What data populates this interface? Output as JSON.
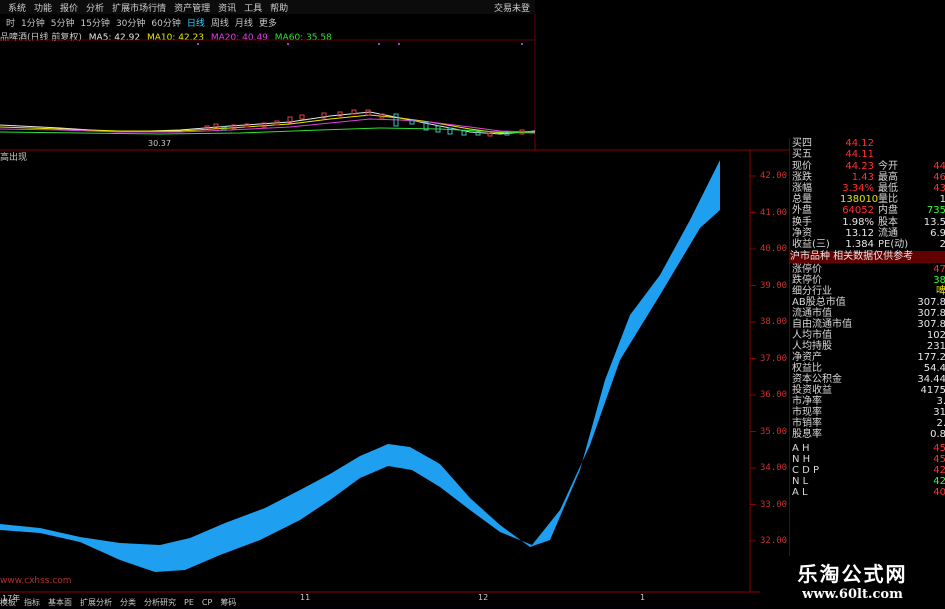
{
  "menu": {
    "items": [
      "系统",
      "功能",
      "报价",
      "分析",
      "扩展市场行情",
      "资产管理",
      "资讯",
      "工具",
      "帮助"
    ],
    "right": "交易未登"
  },
  "periods": {
    "items": [
      "时",
      "1分钟",
      "5分钟",
      "15分钟",
      "30分钟",
      "60分钟",
      "日线",
      "周线",
      "月线",
      "更多"
    ],
    "active": "日线"
  },
  "ma_info": {
    "title": "品啤酒(日线 前复权)",
    "ma5": "MA5: 42.92",
    "ma10": "MA10: 42.23",
    "ma20": "MA20: 40.49",
    "ma60": "MA60: 35.58"
  },
  "top_chart": {
    "low_label": "30.37"
  },
  "sub_chart": {
    "label": "高出现",
    "watermark": "www.cxhss.com"
  },
  "price_scale": [
    "42.00",
    "41.00",
    "40.00",
    "39.00",
    "38.00",
    "37.00",
    "36.00",
    "35.00",
    "34.00",
    "33.00",
    "32.00"
  ],
  "quote": {
    "asks": [
      {
        "label": "买四",
        "value": "44.12"
      },
      {
        "label": "买五",
        "value": "44.11"
      }
    ],
    "rows": [
      {
        "l": "现价",
        "v": "44.23",
        "vc": "red",
        "l2": "今开",
        "v2": "44",
        "v2c": "red"
      },
      {
        "l": "涨跌",
        "v": "1.43",
        "vc": "red",
        "l2": "最高",
        "v2": "46",
        "v2c": "red"
      },
      {
        "l": "涨幅",
        "v": "3.34%",
        "vc": "red",
        "l2": "最低",
        "v2": "43",
        "v2c": "red"
      },
      {
        "l": "总量",
        "v": "138010",
        "vc": "yellow",
        "l2": "量比",
        "v2": "1",
        "v2c": "white"
      },
      {
        "l": "外盘",
        "v": "64052",
        "vc": "red",
        "l2": "内盘",
        "v2": "735",
        "v2c": "green"
      },
      {
        "l": "换手",
        "v": "1.98%",
        "vc": "white",
        "l2": "股本",
        "v2": "13.5",
        "v2c": "white"
      },
      {
        "l": "净资",
        "v": "13.12",
        "vc": "white",
        "l2": "流通",
        "v2": "6.9",
        "v2c": "white"
      },
      {
        "l": "收益(三)",
        "v": "1.384",
        "vc": "white",
        "l2": "PE(动)",
        "v2": "2",
        "v2c": "white"
      }
    ],
    "section_header": "沪市品种  相关数据仅供参考",
    "fund_rows": [
      {
        "l": "涨停价",
        "v": "47",
        "vc": "red"
      },
      {
        "l": "跌停价",
        "v": "38",
        "vc": "green"
      },
      {
        "l": "细分行业",
        "v": "啤",
        "vc": "yellow"
      },
      {
        "l": "AB股总市值",
        "v": "307.8",
        "vc": "white"
      },
      {
        "l": "流通市值",
        "v": "307.8",
        "vc": "white"
      },
      {
        "l": "自由流通市值",
        "v": "307.8",
        "vc": "white"
      },
      {
        "l": "人均市值",
        "v": "102",
        "vc": "white"
      },
      {
        "l": "人均持股",
        "v": "231",
        "vc": "white"
      },
      {
        "l": "净资产",
        "v": "177.2",
        "vc": "white"
      },
      {
        "l": "权益比",
        "v": "54.4",
        "vc": "white"
      },
      {
        "l": "资本公积金",
        "v": "34.44",
        "vc": "white"
      },
      {
        "l": "投资收益",
        "v": "4175",
        "vc": "white"
      },
      {
        "l": "市净率",
        "v": "3.",
        "vc": "white"
      },
      {
        "l": "市现率",
        "v": "31",
        "vc": "white"
      },
      {
        "l": "市销率",
        "v": "2.",
        "vc": "white"
      },
      {
        "l": "股息率",
        "v": "0.8",
        "vc": "white"
      }
    ],
    "indicator_rows": [
      {
        "l": "A H",
        "v": "45",
        "vc": "red"
      },
      {
        "l": "N H",
        "v": "45",
        "vc": "red"
      },
      {
        "l": "C D P",
        "v": "42",
        "vc": "red"
      },
      {
        "l": "N L",
        "v": "42",
        "vc": "green"
      },
      {
        "l": "A L",
        "v": "40",
        "vc": "red"
      }
    ]
  },
  "date_axis": [
    "17年",
    "11",
    "12",
    "1"
  ],
  "bottom_tabs": [
    "模板",
    "指标",
    "基本面",
    "扩展分析",
    "分类",
    "分析研究",
    "PE",
    "CP",
    "筹码"
  ],
  "brand": {
    "name": "乐淘公式网",
    "url": "www.60lt.com"
  },
  "colors": {
    "band": "#1e9ff0",
    "grid": "#8b0000",
    "price_scale": "#c83030"
  }
}
